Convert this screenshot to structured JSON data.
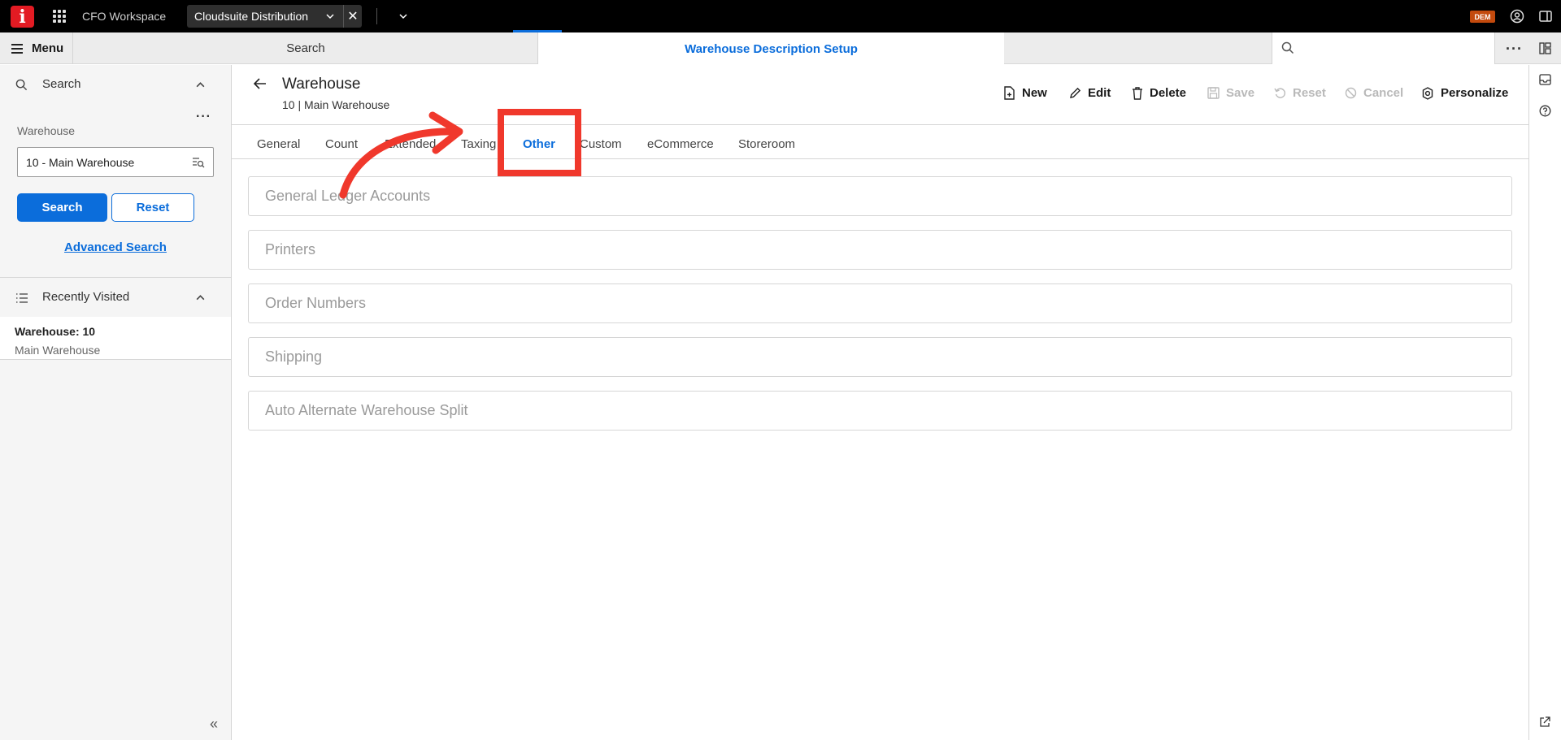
{
  "topbar": {
    "logo_letter": "i",
    "app_title": "CFO Workspace",
    "tenant_name": "Cloudsuite Distribution",
    "env_badge": "DEM"
  },
  "tabstrip": {
    "menu_label": "Menu",
    "search_tab_label": "Search",
    "active_tab_label": "Warehouse Description Setup"
  },
  "left_panel": {
    "search_title": "Search",
    "field_label": "Warehouse",
    "field_value": "10 - Main Warehouse",
    "search_button": "Search",
    "reset_button": "Reset",
    "advanced_search": "Advanced Search",
    "recent_title": "Recently Visited",
    "recent_items": [
      {
        "title": "Warehouse: 10",
        "subtitle": "Main Warehouse"
      }
    ]
  },
  "header": {
    "title": "Warehouse",
    "subtitle": "10 | Main Warehouse"
  },
  "toolbar": {
    "new": "New",
    "edit": "Edit",
    "delete": "Delete",
    "save": "Save",
    "reset": "Reset",
    "cancel": "Cancel",
    "personalize": "Personalize"
  },
  "tabs": [
    {
      "label": "General"
    },
    {
      "label": "Count"
    },
    {
      "label": "Extended"
    },
    {
      "label": "Taxing"
    },
    {
      "label": "Other",
      "active": true
    },
    {
      "label": "Custom"
    },
    {
      "label": "eCommerce"
    },
    {
      "label": "Storeroom"
    }
  ],
  "sections": [
    {
      "label": "General Ledger Accounts"
    },
    {
      "label": "Printers"
    },
    {
      "label": "Order Numbers"
    },
    {
      "label": "Shipping"
    },
    {
      "label": "Auto Alternate Warehouse Split"
    }
  ],
  "colors": {
    "accent": "#0b6ddb",
    "annotation": "#f0382c",
    "brand": "#e31b23"
  }
}
